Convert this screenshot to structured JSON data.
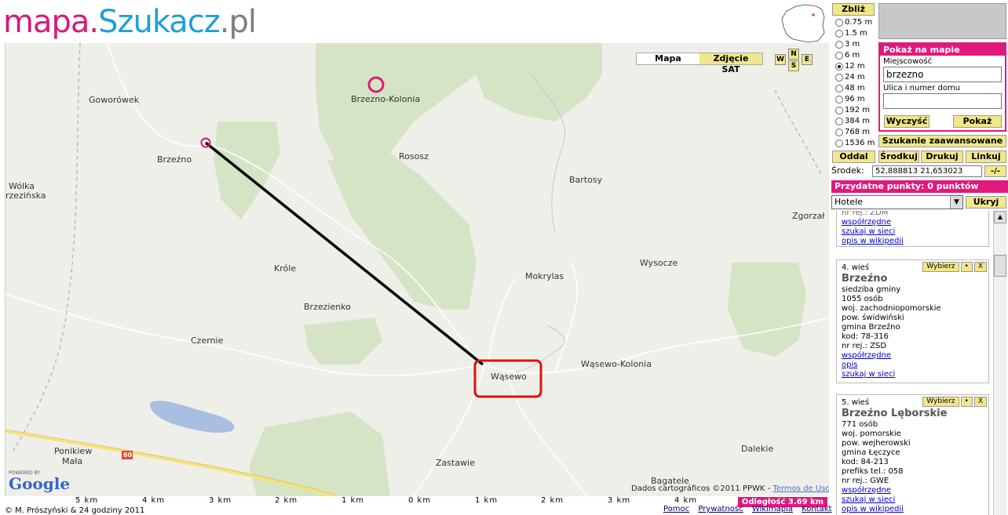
{
  "logo": {
    "part1": "mapa.",
    "part2": "Szukacz",
    "part3": ".pl"
  },
  "map": {
    "type_buttons": {
      "map": "Mapa",
      "sat": "Zdjęcie SAT"
    },
    "compass": {
      "w": "W",
      "n": "N",
      "s": "S",
      "e": "E"
    },
    "places": [
      "Goworówek",
      "Brzezno-Kolonia",
      "Brzeźno",
      "Rososz",
      "Bartosy",
      "Wólka",
      "rzezińska",
      "Zgorzał",
      "Wysocze",
      "Króle",
      "Mokrylas",
      "Brzezienko",
      "Czernie",
      "Wąsewo",
      "Wąsewo-Kolonia",
      "Ponikiew",
      "Mała",
      "Zastawie",
      "Dalekie",
      "Bagatele"
    ],
    "road_number": "60",
    "google": {
      "powered_by": "POWERED BY",
      "brand": "Google"
    },
    "copyright": "Dados cartográficos ©2011 PPWK - ",
    "terms": "Termos de Uso"
  },
  "scale": [
    "5 km",
    "4 km",
    "3 km",
    "2 km",
    "1 km",
    "0 km",
    "1 km",
    "2 km",
    "3 km",
    "4 km"
  ],
  "distance": "Odległość  3.69 km",
  "footer": {
    "copyright": "© M. Prószyński & 24 godziny 2011",
    "links": [
      "Pomoc",
      "Prywatność",
      "Wikimapia",
      "Kontakt"
    ]
  },
  "panel": {
    "zoom_in": "Zbliż",
    "zoom_levels": [
      "0.75 m",
      "1.5 m",
      "3 m",
      "6 m",
      "12 m",
      "24 m",
      "48 m",
      "96 m",
      "192 m",
      "384 m",
      "768 m",
      "1536 m"
    ],
    "selected_zoom": "12 m",
    "show_title": "Pokaż na mapie",
    "city_label": "Miejscowość",
    "city_value": "brzezno",
    "street_label": "Ulica i numer domu",
    "street_value": "",
    "clear_btn": "Wyczyść",
    "show_btn": "Pokaż",
    "advanced_btn": "Szukanie zaawansowane",
    "oddal": "Oddal",
    "srodkuj": "Środkuj",
    "drukuj": "Drukuj",
    "linkuj": "Linkuj",
    "srodek_label": "Środek:",
    "srodek_value": "52,888813 21,653023",
    "toggle": "-/-",
    "points_title": "Przydatne punkty: 0 punktów",
    "category": "Hotele",
    "hide_btn": "Ukryj"
  },
  "results": {
    "partial": {
      "cut_line": "nr rej.: ZDM",
      "links": [
        "współrzędne",
        "szukaj w sieci",
        "opis w wikipedii"
      ]
    },
    "items": [
      {
        "number": "4. wieś",
        "title": "Brzeźno",
        "lines": [
          "siedziba gminy",
          "1055 osób",
          "woj. zachodniopomorskie",
          "pow. świdwiński",
          "gmina Brzeźno",
          "kod: 78-316",
          "nr rej.: ZSD"
        ],
        "links": [
          "współrzędne",
          "opis",
          "szukaj w sieci"
        ],
        "select": "Wybierz",
        "dot": "•",
        "close": "X"
      },
      {
        "number": "5. wieś",
        "title": "Brzeźno Lęborskie",
        "lines": [
          "771 osób",
          "woj. pomorskie",
          "pow. wejherowski",
          "gmina Łęczyce",
          "kod: 84-213",
          "prefiks tel.: 058",
          "nr rej.: GWE"
        ],
        "links": [
          "współrzędne",
          "szukaj w sieci",
          "opis w wikipedii"
        ],
        "select": "Wybierz",
        "dot": "•",
        "close": "X"
      }
    ]
  },
  "colors": {
    "accent": "#e2197d",
    "button": "#f2e68a",
    "forest": "#d6e4c6",
    "route": "#000000",
    "marker": "#e2197d",
    "highlight": "#e01010"
  }
}
